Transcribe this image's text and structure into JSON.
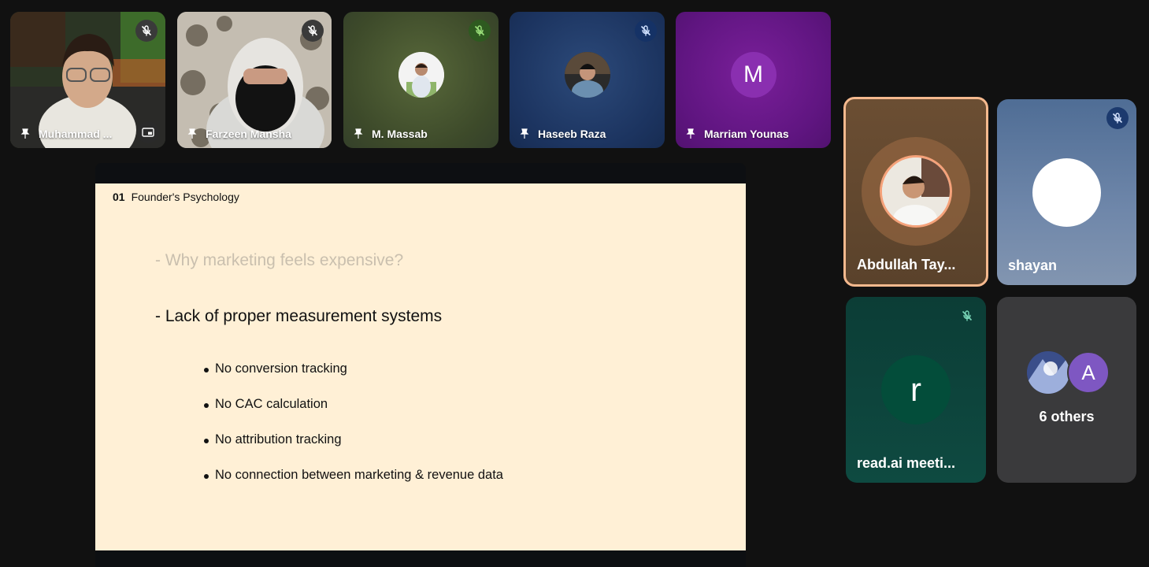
{
  "tiles": [
    {
      "name": "Muhammad ...",
      "mic": "muted",
      "badge_color": "#3a3a3a"
    },
    {
      "name": "Farzeen Mansha",
      "mic": "muted",
      "badge_color": "#3a3a3a"
    },
    {
      "name": "M. Massab",
      "mic": "muted",
      "badge_color": "#2e5a20"
    },
    {
      "name": "Haseeb Raza",
      "mic": "muted",
      "badge_color": "#153266"
    },
    {
      "name": "Marriam Younas",
      "letter": "M"
    }
  ],
  "slide": {
    "section_num": "01",
    "section_title": "Founder's Psychology",
    "faded_line": "- Why marketing feels expensive?",
    "heading": "- Lack of proper measurement systems",
    "bullets": [
      "No conversion tracking",
      "No CAC calculation",
      "No attribution tracking",
      "No connection between marketing & revenue data"
    ]
  },
  "side": {
    "speaker_name": "Abdullah Tay...",
    "shayan_name": "shayan",
    "readai_name": "read.ai meeti...",
    "readai_letter": "r",
    "others_letter": "A",
    "others_label": "6 others"
  },
  "colors": {
    "active_speaker_border": "#f5b98e",
    "slide_bg": "#fff0d6"
  }
}
